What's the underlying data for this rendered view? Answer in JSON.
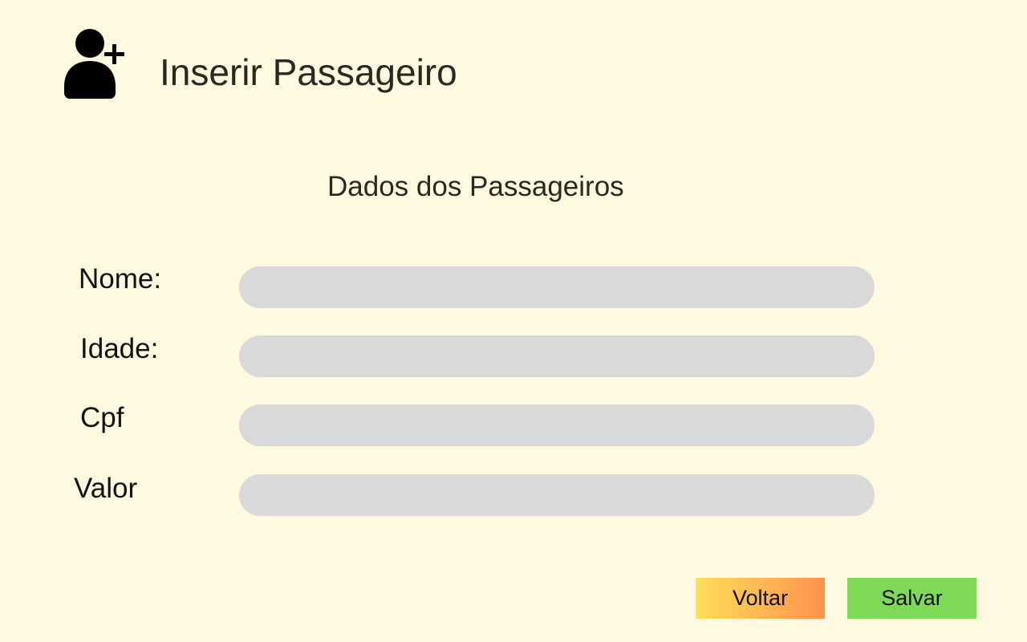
{
  "header": {
    "title": "Inserir Passageiro",
    "icon": "add-user-icon"
  },
  "form": {
    "section_title": "Dados dos Passageiros",
    "fields": [
      {
        "label": "Nome:",
        "value": "",
        "placeholder": ""
      },
      {
        "label": "Idade:",
        "value": "",
        "placeholder": ""
      },
      {
        "label": "Cpf",
        "value": "",
        "placeholder": ""
      },
      {
        "label": "Valor",
        "value": "",
        "placeholder": ""
      }
    ]
  },
  "actions": {
    "back_label": "Voltar",
    "save_label": "Salvar"
  },
  "colors": {
    "background": "#fff9e0",
    "input_fill": "#d9d9d9",
    "back_gradient_start": "#ffde59",
    "back_gradient_end": "#ff914d",
    "save": "#7ed957",
    "text": "#2e2620"
  }
}
